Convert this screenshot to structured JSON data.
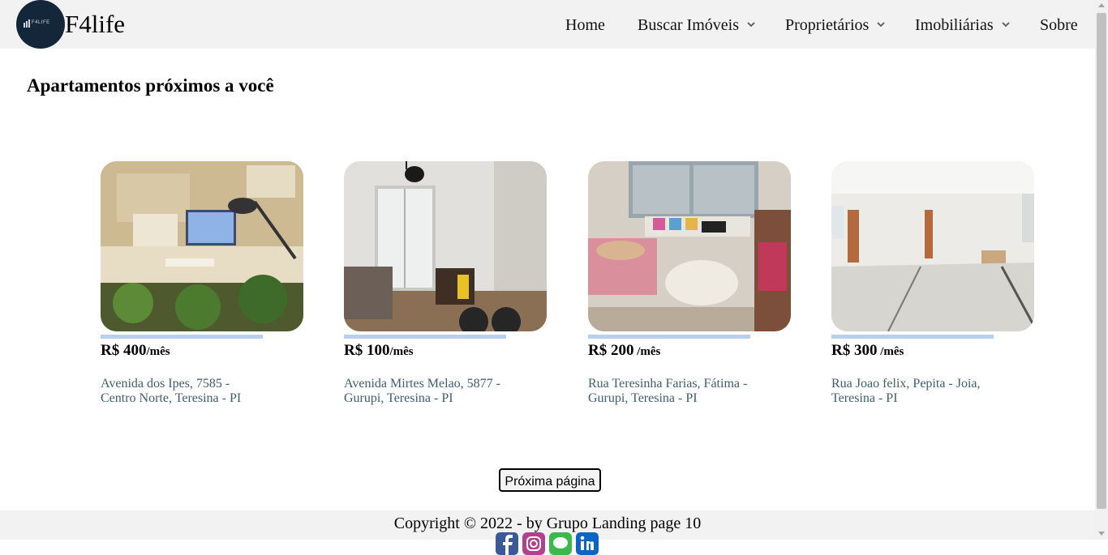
{
  "brand": {
    "name": "F4life",
    "logo_text": "F4LIFE"
  },
  "nav": [
    {
      "label": "Home",
      "dropdown": false
    },
    {
      "label": "Buscar Imóveis",
      "dropdown": true
    },
    {
      "label": "Proprietários",
      "dropdown": true
    },
    {
      "label": "Imobiliárias",
      "dropdown": true
    },
    {
      "label": "Sobre",
      "dropdown": false
    }
  ],
  "section_title": "Apartamentos próximos a você",
  "listings": [
    {
      "price": "R$ 400",
      "period": "/mês",
      "address": "Avenida dos Ipes, 7585 - Centro Norte, Teresina - PI",
      "photo": "desk-room"
    },
    {
      "price": "R$ 100",
      "period": "/mês",
      "address": "Avenida Mirtes Melao, 5877 - Gurupi, Teresina - PI",
      "photo": "living-room"
    },
    {
      "price": "R$ 200",
      "period": " /mês",
      "address": "Rua Teresinha Farias, Fátima - Gurupi, Teresina - PI",
      "photo": "bedroom"
    },
    {
      "price": "R$ 300",
      "period": " /mês",
      "address": "Rua Joao felix, Pepita - Joia, Teresina - PI",
      "photo": "empty-hall"
    }
  ],
  "next_page_label": "Próxima página",
  "footer": {
    "copyright": "Copyright © 2022 - by Grupo Landing page 10",
    "social": [
      "facebook-icon",
      "instagram-icon",
      "messages-icon",
      "linkedin-icon"
    ]
  },
  "colors": {
    "header_bg": "#f2f2f2",
    "accent_bar": "#b8cff0",
    "address_text": "#3e5d6e",
    "logo_bg": "#13263a"
  }
}
